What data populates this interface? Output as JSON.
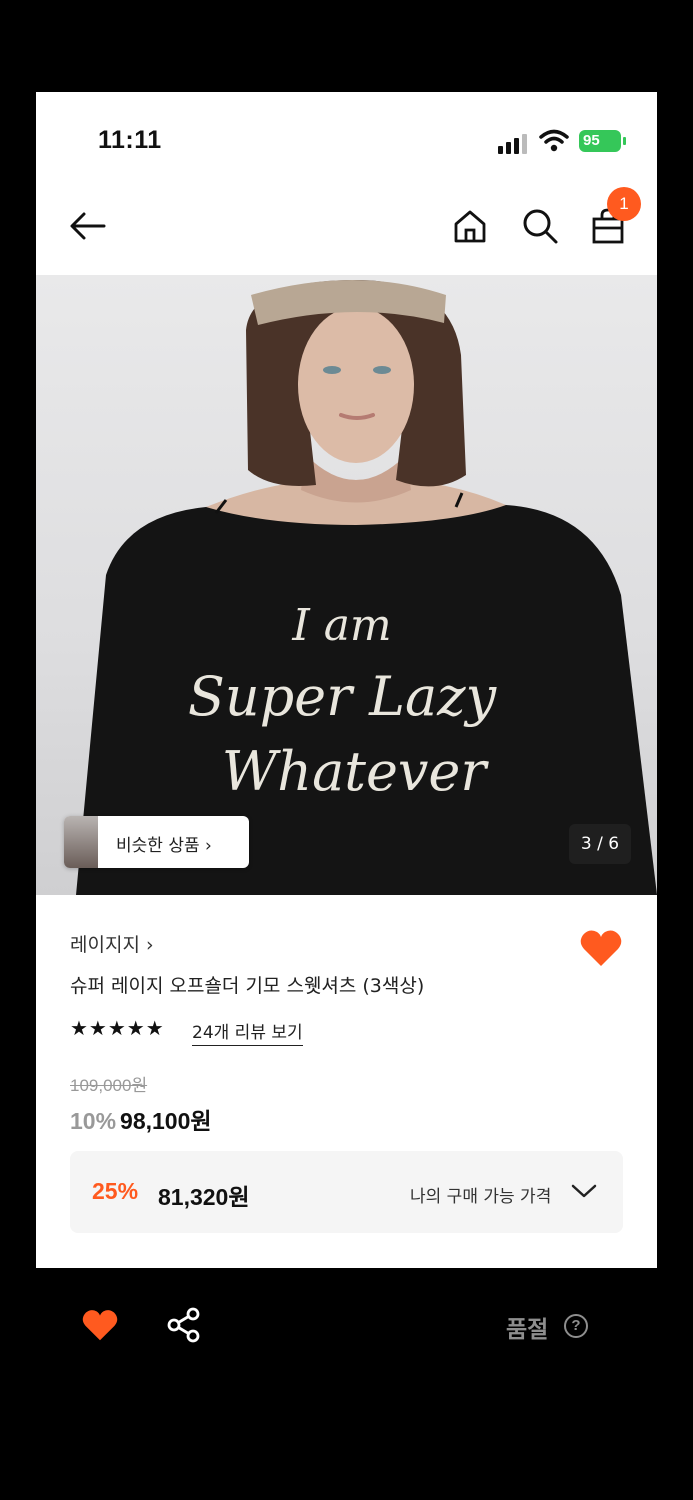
{
  "status_bar": {
    "time": "11:11",
    "battery": "95"
  },
  "header": {
    "cart_count": "1"
  },
  "hero": {
    "graphic_text": [
      "I am",
      "Super Lazy",
      "Whatever"
    ],
    "similar_label": "비슷한 상품",
    "image_counter": "3 / 6"
  },
  "product": {
    "brand": "레이지지",
    "title": "슈퍼 레이지 오프숄더 기모 스웻셔츠 (3색상)",
    "stars": "★★★★★",
    "reviews_link": "24개 리뷰 보기",
    "original_price": "109,000원",
    "discount_pct": "10%",
    "sale_price": "98,100원",
    "my_price_pct": "25%",
    "my_price": "81,320원",
    "my_price_label": "나의 구매 가능 가격"
  },
  "bottom_bar": {
    "soldout_label": "품절",
    "help_glyph": "?"
  },
  "colors": {
    "accent": "#ff5a1f",
    "muted": "#8e8e8e",
    "battery": "#35c759"
  }
}
